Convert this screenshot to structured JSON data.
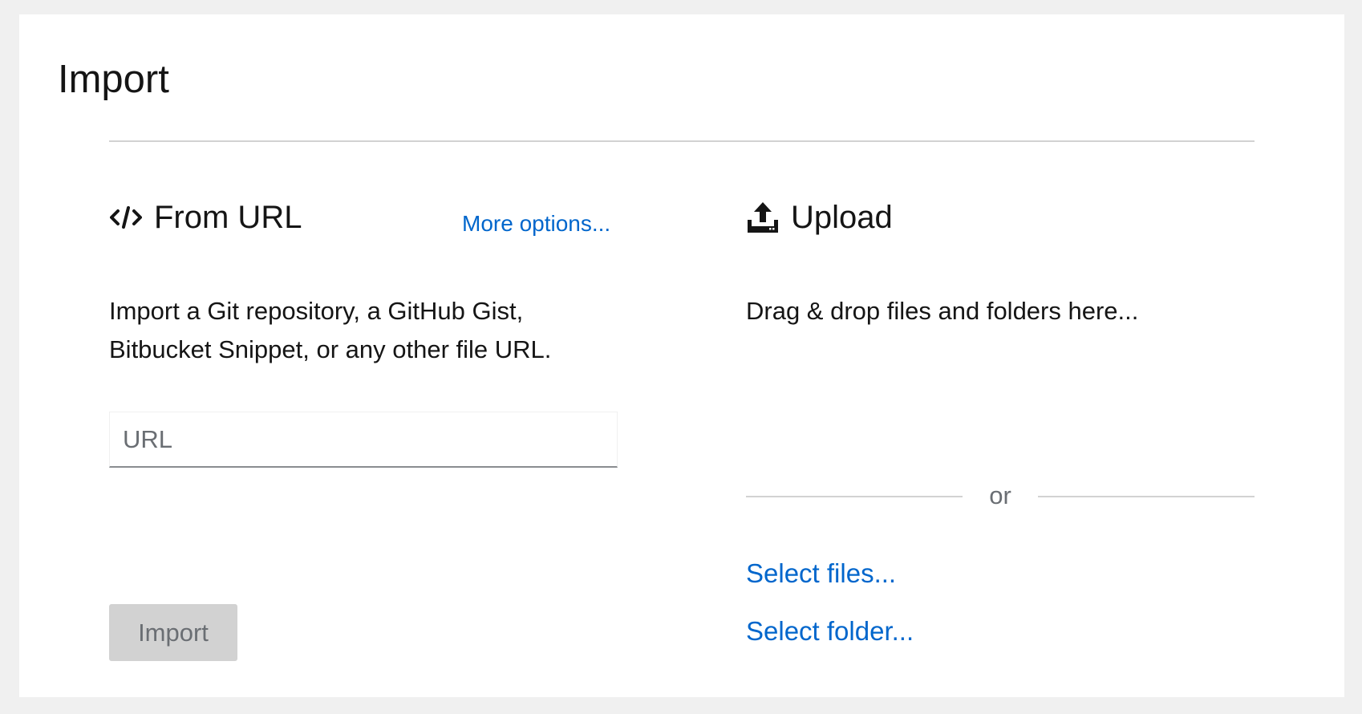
{
  "page": {
    "title": "Import"
  },
  "from_url": {
    "icon": "code-icon",
    "title": "From URL",
    "more_options": "More options...",
    "description_line1": "Import a Git repository, a GitHub Gist,",
    "description_line2": "Bitbucket Snippet, or any other file URL.",
    "url_input": {
      "value": "",
      "placeholder": "URL"
    },
    "import_button": "Import"
  },
  "upload": {
    "icon": "upload-icon",
    "title": "Upload",
    "drop_text": "Drag & drop files and folders here...",
    "or_text": "or",
    "select_files": "Select files...",
    "select_folder": "Select folder..."
  },
  "colors": {
    "link": "#0066cc",
    "text": "#151515",
    "muted": "#6a6e73",
    "divider": "#d2d2d2",
    "disabled_button": "#d2d2d2"
  }
}
